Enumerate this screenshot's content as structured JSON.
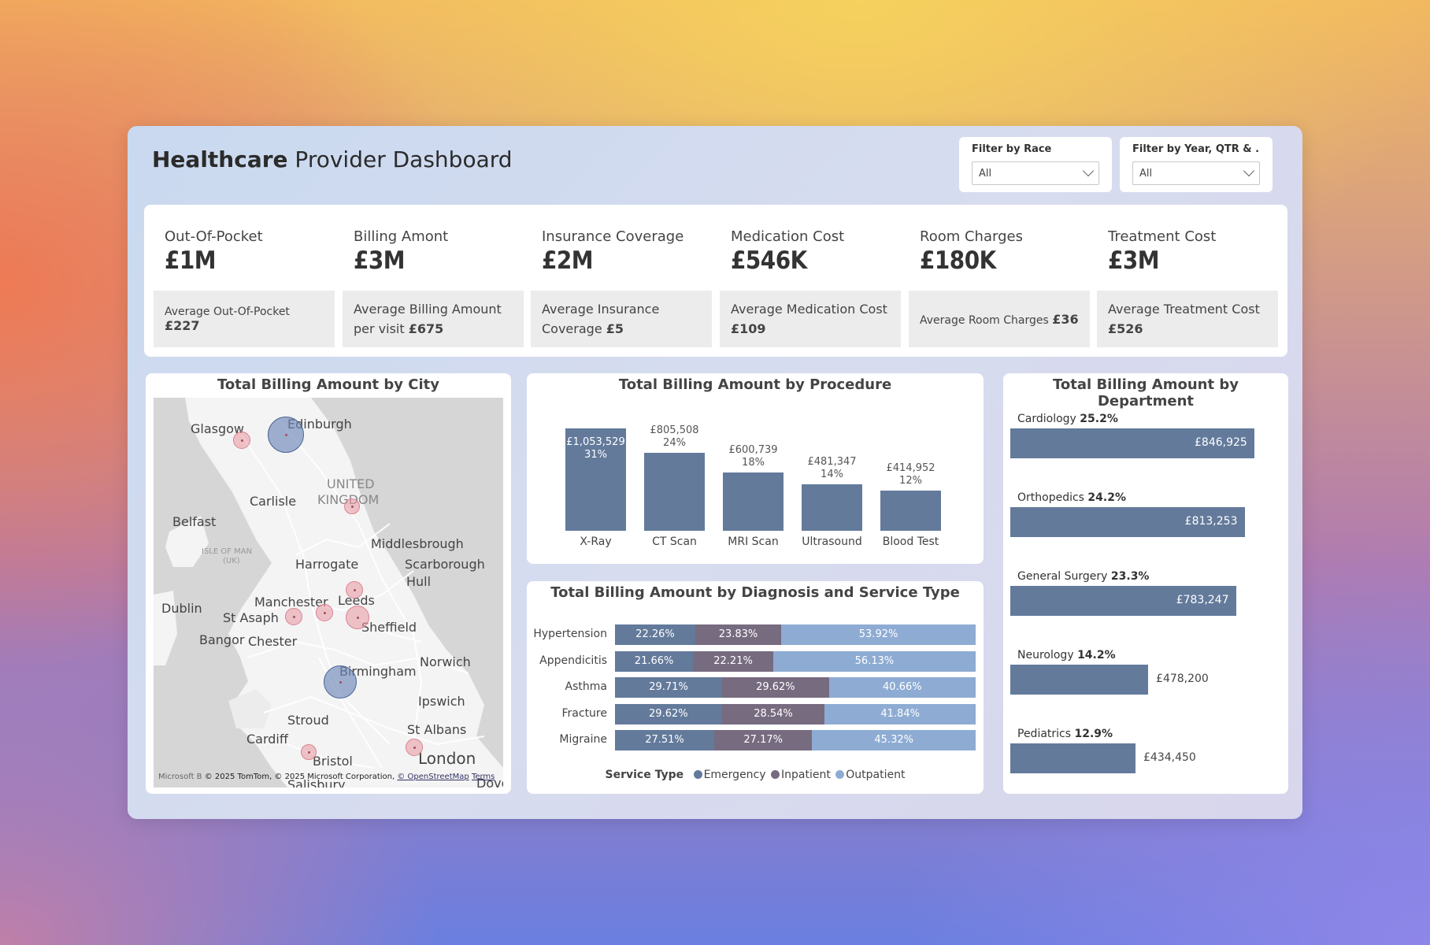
{
  "header": {
    "title_bold": "Healthcare",
    "title_rest": " Provider Dashboard",
    "filters": [
      {
        "label": "Filter by Race",
        "value": "All"
      },
      {
        "label": "Filter by Year, QTR & ...",
        "value": "All"
      }
    ]
  },
  "kpis": [
    {
      "label": "Out-Of-Pocket",
      "value": "£1M",
      "avg_label": "Average Out-Of-Pocket ",
      "avg_value": "£227"
    },
    {
      "label": "Billing Amont",
      "value": "£3M",
      "avg_label": "Average Billing Amount per visit ",
      "avg_value": "£675"
    },
    {
      "label": "Insurance Coverage",
      "value": "£2M",
      "avg_label": "Average Insurance Coverage ",
      "avg_value": "£5"
    },
    {
      "label": "Medication Cost",
      "value": "£546K",
      "avg_label": "Average Medication Cost ",
      "avg_value": "£109"
    },
    {
      "label": "Room Charges",
      "value": "£180K",
      "avg_label": "Average Room Charges ",
      "avg_value": "£36"
    },
    {
      "label": "Treatment Cost",
      "value": "£3M",
      "avg_label": "Average Treatment Cost ",
      "avg_value": "£526"
    }
  ],
  "map_card": {
    "title": "Total Billing Amount by City",
    "labels": {
      "glasgow": "Glasgow",
      "edinburgh": "Edinburgh",
      "uk1": "UNITED",
      "uk2": "KINGDOM",
      "carlisle": "Carlisle",
      "belfast": "Belfast",
      "middlesbrough": "Middlesbrough",
      "isle1": "ISLE OF MAN",
      "isle2": "(UK)",
      "harrogate": "Harrogate",
      "scarborough": "Scarborough",
      "hull": "Hull",
      "dublin": "Dublin",
      "manchester": "Manchester",
      "leeds": "Leeds",
      "stasaph": "St Asaph",
      "sheffield": "Sheffield",
      "bangor": "Bangor",
      "chester": "Chester",
      "birmingham": "Birmingham",
      "norwich": "Norwich",
      "ipswich": "Ipswich",
      "stroud": "Stroud",
      "cardiff": "Cardiff",
      "stalbans": "St Albans",
      "bristol": "Bristol",
      "london": "London",
      "salisbury": "Salisbury",
      "dover": "Dover"
    },
    "attribution": {
      "microsoft": "Microsoft B",
      "text": "© 2025 TomTom, © 2025 Microsoft Corporation, ",
      "osm": "© OpenStreetMap",
      "terms": "Terms"
    }
  },
  "procedure_card": {
    "title": "Total Billing Amount by Procedure"
  },
  "diagnosis_card": {
    "title": "Total Billing Amount by Diagnosis and Service Type",
    "legend_title": "Service Type",
    "legend": [
      {
        "name": "Emergency",
        "color": "#637a9b"
      },
      {
        "name": "Inpatient",
        "color": "#776b80"
      },
      {
        "name": "Outpatient",
        "color": "#8eacd3"
      }
    ]
  },
  "department_card": {
    "title": "Total Billing Amount by Department"
  },
  "chart_data": [
    {
      "type": "bar",
      "title": "Total Billing Amount by Procedure",
      "categories": [
        "X-Ray",
        "CT Scan",
        "MRI Scan",
        "Ultrasound",
        "Blood Test"
      ],
      "values": [
        1053529,
        805508,
        600739,
        481347,
        414952
      ],
      "value_labels": [
        "£1,053,529",
        "£805,508",
        "£600,739",
        "£481,347",
        "£414,952"
      ],
      "percent_labels": [
        "31%",
        "24%",
        "18%",
        "14%",
        "12%"
      ]
    },
    {
      "type": "bar",
      "orientation": "horizontal-stacked-100",
      "title": "Total Billing Amount by Diagnosis and Service Type",
      "categories": [
        "Hypertension",
        "Appendicitis",
        "Asthma",
        "Fracture",
        "Migraine"
      ],
      "series": [
        {
          "name": "Emergency",
          "values": [
            22.26,
            21.66,
            29.71,
            29.62,
            27.51
          ]
        },
        {
          "name": "Inpatient",
          "values": [
            23.83,
            22.21,
            29.62,
            28.54,
            27.17
          ]
        },
        {
          "name": "Outpatient",
          "values": [
            53.92,
            56.13,
            40.66,
            41.84,
            45.32
          ]
        }
      ],
      "legend_title": "Service Type"
    },
    {
      "type": "bar",
      "orientation": "horizontal",
      "title": "Total Billing Amount by Department",
      "categories": [
        "Cardiology",
        "Orthopedics",
        "General Surgery",
        "Neurology",
        "Pediatrics"
      ],
      "values": [
        846925,
        813253,
        783247,
        478200,
        434450
      ],
      "value_labels": [
        "£846,925",
        "£813,253",
        "£783,247",
        "£478,200",
        "£434,450"
      ],
      "percent_labels": [
        "25.2%",
        "24.2%",
        "23.3%",
        "14.2%",
        "12.9%"
      ]
    }
  ]
}
